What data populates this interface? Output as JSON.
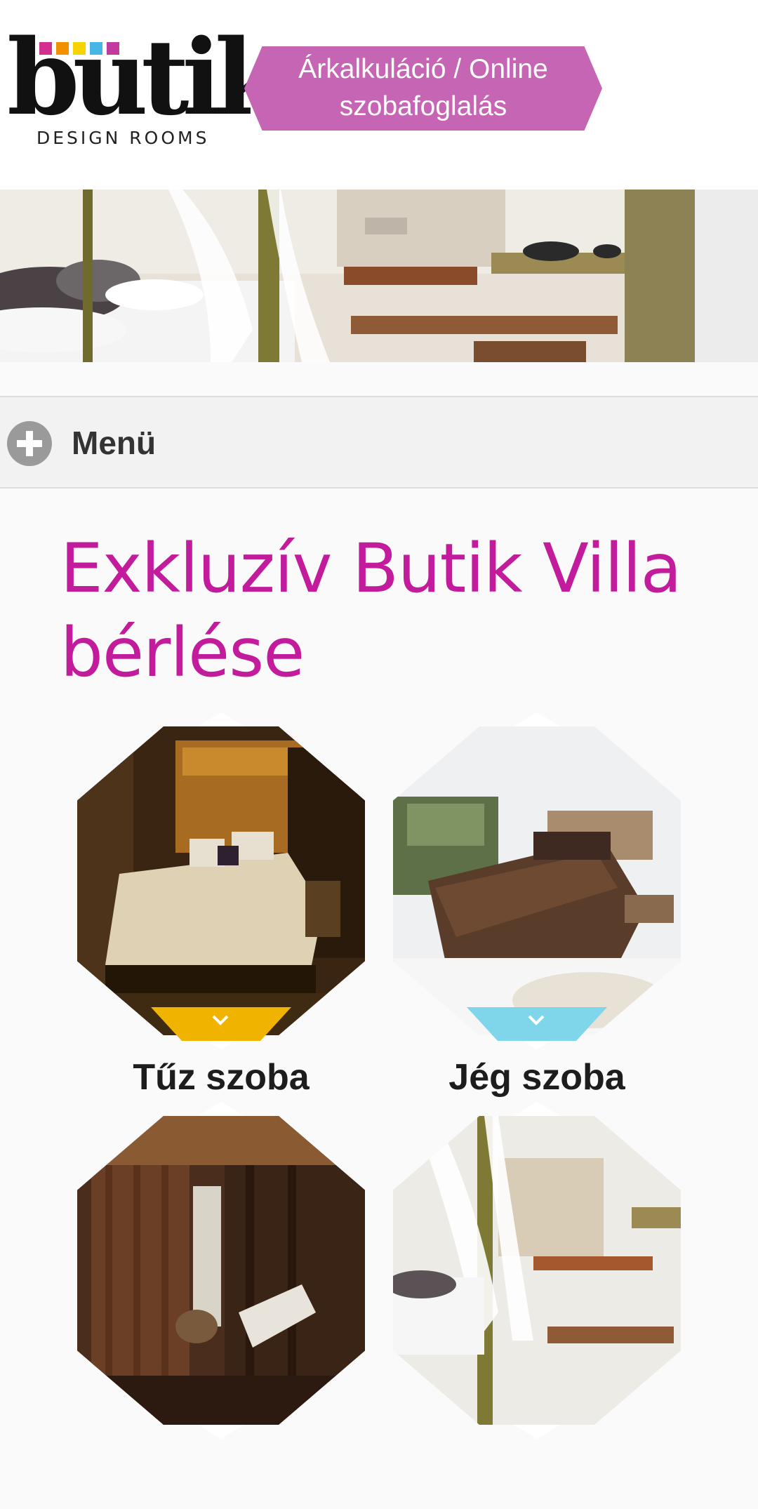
{
  "header": {
    "logo_text": "butik",
    "logo_subtitle": "DESIGN ROOMS",
    "logo_square_colors": [
      "#d22f8f",
      "#f29100",
      "#f6d400",
      "#45b7e6",
      "#c33a9e"
    ],
    "cta_line1": "Árkalkuláció / Online",
    "cta_line2": "szobafoglalás",
    "cta_color": "#c665b4"
  },
  "banner": {
    "image": "hotel-suite-photo"
  },
  "menu": {
    "label": "Menü",
    "icon": "plus-circle-icon"
  },
  "main": {
    "title": "Exkluzív Butik Villa bérlése",
    "title_color": "#c21b9b",
    "rooms": [
      {
        "name": "Tűz szoba",
        "tab_color": "#f0b400",
        "image": "fire-room-photo"
      },
      {
        "name": "Jég szoba",
        "tab_color": "#7fd6ea",
        "image": "ice-room-photo"
      },
      {
        "name": "",
        "tab_color": "",
        "image": "wood-room-photo"
      },
      {
        "name": "",
        "tab_color": "",
        "image": "white-room-photo"
      }
    ]
  }
}
